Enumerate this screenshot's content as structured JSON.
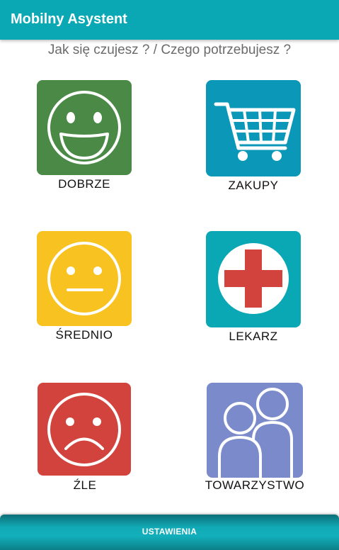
{
  "app": {
    "title": "Mobilny Asystent",
    "accent_color": "#0aa8b4"
  },
  "prompt": "Jak się czujesz ? / Czego potrzebujesz ?",
  "tiles": [
    {
      "label": "DOBRZE",
      "icon": "happy-face-icon",
      "color": "#4a8a46"
    },
    {
      "label": "ZAKUPY",
      "icon": "shopping-cart-icon",
      "color": "#0a97b8"
    },
    {
      "label": "ŚREDNIO",
      "icon": "neutral-face-icon",
      "color": "#f8c220"
    },
    {
      "label": "LEKARZ",
      "icon": "medical-cross-icon",
      "color": "#0aa8b4"
    },
    {
      "label": "ŹLE",
      "icon": "sad-face-icon",
      "color": "#d2433d"
    },
    {
      "label": "TOWARZYSTWO",
      "icon": "people-icon",
      "color": "#7b8acb"
    }
  ],
  "settings_button": {
    "label": "USTAWIENIA"
  }
}
